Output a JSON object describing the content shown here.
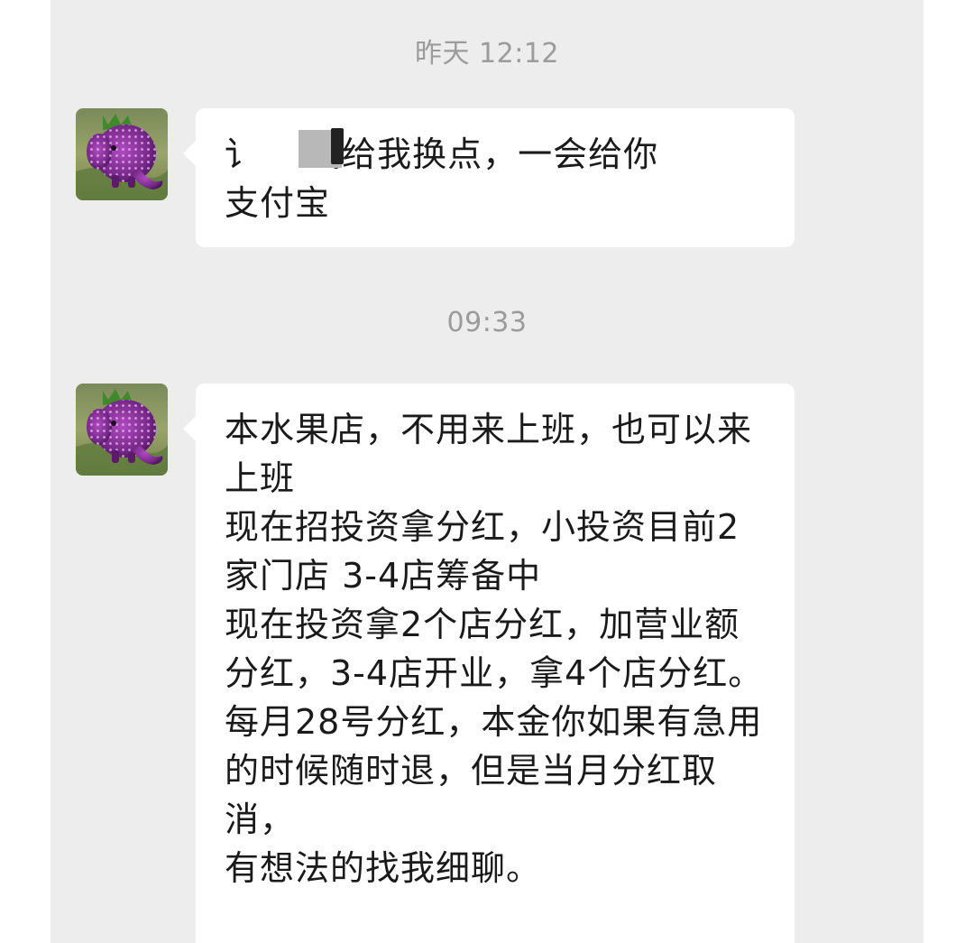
{
  "chat": {
    "messages": [
      {
        "timestamp": "昨天 12:12",
        "sender_avatar": "purple-strawberry-elephant-avatar",
        "text": "讠 有钱给我换点，一会给你\n支付宝"
      },
      {
        "timestamp": "09:33",
        "sender_avatar": "purple-strawberry-elephant-avatar",
        "text": "本水果店，不用来上班，也可以来上班\n现在招投资拿分红，小投资目前2家门店 3-4店筹备中\n现在投资拿2个店分红，加营业额分红，3-4店开业，拿4个店分红。\n每月28号分红，本金你如果有急用的时候随时退，但是当月分红取消，\n有想法的找我细聊。"
      }
    ]
  },
  "colors": {
    "chat_background": "#ededed",
    "bubble_background": "#ffffff",
    "timestamp_text": "#9b9b9b",
    "message_text": "#1a1a1a"
  }
}
